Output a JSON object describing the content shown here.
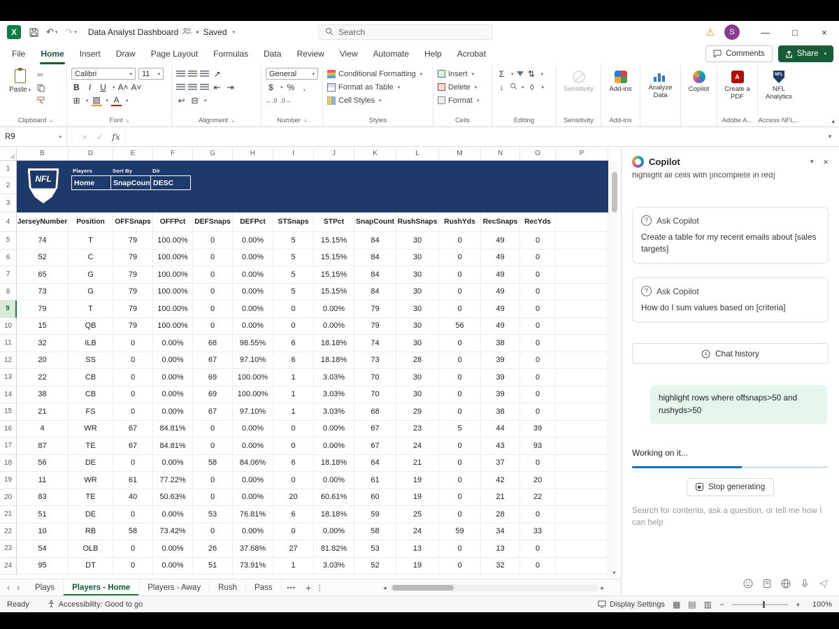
{
  "titlebar": {
    "title": "Data Analyst Dashboard",
    "saved": "Saved",
    "search_placeholder": "Search",
    "avatar": "S"
  },
  "ribbon": {
    "tabs": [
      "File",
      "Home",
      "Insert",
      "Draw",
      "Page Layout",
      "Formulas",
      "Data",
      "Review",
      "View",
      "Automate",
      "Help",
      "Acrobat"
    ],
    "active_tab": "Home",
    "comments": "Comments",
    "share": "Share",
    "clipboard": {
      "paste": "Paste",
      "label": "Clipboard"
    },
    "font": {
      "family": "Calibri",
      "size": "11",
      "label": "Font"
    },
    "alignment": {
      "label": "Alignment"
    },
    "number": {
      "format": "General",
      "label": "Number"
    },
    "styles": {
      "items": [
        "Conditional Formatting",
        "Format as Table",
        "Cell Styles"
      ],
      "label": "Styles"
    },
    "cells": {
      "items": [
        "Insert",
        "Delete",
        "Format"
      ],
      "label": "Cells"
    },
    "editing": {
      "label": "Editing"
    },
    "sensitivity": {
      "button": "Sensitivity",
      "label": "Sensitivity"
    },
    "addins": {
      "button": "Add-ins",
      "label": "Add-ins"
    },
    "analyze": "Analyze Data",
    "copilot": "Copilot",
    "adobe": {
      "button": "Create a PDF",
      "label": "Adobe A..."
    },
    "nfl": {
      "button": "NFL Analytics",
      "label": "Access NFL..."
    }
  },
  "formula_bar": {
    "name_box": "R9",
    "fx": "fx"
  },
  "sheet": {
    "column_letters": [
      "B",
      "D",
      "E",
      "F",
      "G",
      "H",
      "I",
      "J",
      "K",
      "L",
      "M",
      "N",
      "O",
      "P"
    ],
    "row_count": 24,
    "selected_row": 9,
    "first_data_row": 5,
    "banner": {
      "logo": "NFL",
      "fields": [
        {
          "label": "Players",
          "value": "Home"
        },
        {
          "label": "Sort By",
          "value": "SnapCount"
        },
        {
          "label": "Dir",
          "value": "DESC"
        }
      ]
    },
    "headers": [
      "JerseyNumber",
      "Position",
      "OFFSnaps",
      "OFFPct",
      "DEFSnaps",
      "DEFPct",
      "STSnaps",
      "STPct",
      "SnapCount",
      "RushSnaps",
      "RushYds",
      "RecSnaps",
      "RecYds"
    ],
    "rows": [
      [
        "74",
        "T",
        "79",
        "100.00%",
        "0",
        "0.00%",
        "5",
        "15.15%",
        "84",
        "30",
        "0",
        "49",
        "0"
      ],
      [
        "52",
        "C",
        "79",
        "100.00%",
        "0",
        "0.00%",
        "5",
        "15.15%",
        "84",
        "30",
        "0",
        "49",
        "0"
      ],
      [
        "65",
        "G",
        "79",
        "100.00%",
        "0",
        "0.00%",
        "5",
        "15.15%",
        "84",
        "30",
        "0",
        "49",
        "0"
      ],
      [
        "73",
        "G",
        "79",
        "100.00%",
        "0",
        "0.00%",
        "5",
        "15.15%",
        "84",
        "30",
        "0",
        "49",
        "0"
      ],
      [
        "79",
        "T",
        "79",
        "100.00%",
        "0",
        "0.00%",
        "0",
        "0.00%",
        "79",
        "30",
        "0",
        "49",
        "0"
      ],
      [
        "15",
        "QB",
        "79",
        "100.00%",
        "0",
        "0.00%",
        "0",
        "0.00%",
        "79",
        "30",
        "56",
        "49",
        "0"
      ],
      [
        "32",
        "ILB",
        "0",
        "0.00%",
        "68",
        "98.55%",
        "6",
        "18.18%",
        "74",
        "30",
        "0",
        "38",
        "0"
      ],
      [
        "20",
        "SS",
        "0",
        "0.00%",
        "67",
        "97.10%",
        "6",
        "18.18%",
        "73",
        "28",
        "0",
        "39",
        "0"
      ],
      [
        "22",
        "CB",
        "0",
        "0.00%",
        "69",
        "100.00%",
        "1",
        "3.03%",
        "70",
        "30",
        "0",
        "39",
        "0"
      ],
      [
        "38",
        "CB",
        "0",
        "0.00%",
        "69",
        "100.00%",
        "1",
        "3.03%",
        "70",
        "30",
        "0",
        "39",
        "0"
      ],
      [
        "21",
        "FS",
        "0",
        "0.00%",
        "67",
        "97.10%",
        "1",
        "3.03%",
        "68",
        "29",
        "0",
        "38",
        "0"
      ],
      [
        "4",
        "WR",
        "67",
        "84.81%",
        "0",
        "0.00%",
        "0",
        "0.00%",
        "67",
        "23",
        "5",
        "44",
        "39"
      ],
      [
        "87",
        "TE",
        "67",
        "84.81%",
        "0",
        "0.00%",
        "0",
        "0.00%",
        "67",
        "24",
        "0",
        "43",
        "93"
      ],
      [
        "56",
        "DE",
        "0",
        "0.00%",
        "58",
        "84.06%",
        "6",
        "18.18%",
        "64",
        "21",
        "0",
        "37",
        "0"
      ],
      [
        "11",
        "WR",
        "61",
        "77.22%",
        "0",
        "0.00%",
        "0",
        "0.00%",
        "61",
        "19",
        "0",
        "42",
        "20"
      ],
      [
        "83",
        "TE",
        "40",
        "50.63%",
        "0",
        "0.00%",
        "20",
        "60.61%",
        "60",
        "19",
        "0",
        "21",
        "22"
      ],
      [
        "51",
        "DE",
        "0",
        "0.00%",
        "53",
        "76.81%",
        "6",
        "18.18%",
        "59",
        "25",
        "0",
        "28",
        "0"
      ],
      [
        "10",
        "RB",
        "58",
        "73.42%",
        "0",
        "0.00%",
        "0",
        "0.00%",
        "58",
        "24",
        "59",
        "34",
        "33"
      ],
      [
        "54",
        "OLB",
        "0",
        "0.00%",
        "26",
        "37.68%",
        "27",
        "81.82%",
        "53",
        "13",
        "0",
        "13",
        "0"
      ],
      [
        "95",
        "DT",
        "0",
        "0.00%",
        "51",
        "73.91%",
        "1",
        "3.03%",
        "52",
        "19",
        "0",
        "32",
        "0"
      ]
    ]
  },
  "sheet_tabs": {
    "tabs": [
      "Plays",
      "Players - Home",
      "Players - Away",
      "Rush",
      "Pass"
    ],
    "active": "Players - Home"
  },
  "status_bar": {
    "ready": "Ready",
    "accessibility": "Accessibility: Good to go",
    "display_settings": "Display Settings",
    "zoom": "100%"
  },
  "copilot": {
    "title": "Copilot",
    "scrolled_message": "highlight all cells with [incomplete in red]",
    "cards": [
      {
        "header": "Ask Copilot",
        "body": "Create a table for my recent emails about [sales targets]"
      },
      {
        "header": "Ask Copilot",
        "body": "How do I sum values based on [criteria]"
      }
    ],
    "chat_history": "Chat history",
    "user_message": "highlight rows where offsnaps>50 and rushyds>50",
    "status": "Working on it...",
    "stop": "Stop generating",
    "input_placeholder": "Search for contents, ask a question, or tell me how I can help"
  }
}
